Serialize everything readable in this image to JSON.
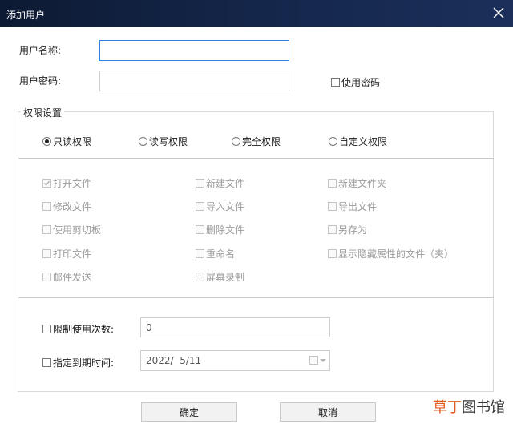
{
  "window": {
    "title": "添加用户"
  },
  "form": {
    "username_label": "用户名称:",
    "username_value": "",
    "password_label": "用户密码:",
    "password_value": "",
    "use_password_label": "使用密码",
    "use_password_checked": false
  },
  "permissions": {
    "group_title": "权限设置",
    "levels": [
      {
        "label": "只读权限",
        "selected": true
      },
      {
        "label": "读写权限",
        "selected": false
      },
      {
        "label": "完全权限",
        "selected": false
      },
      {
        "label": "自定义权限",
        "selected": false
      }
    ],
    "options": [
      {
        "label": "打开文件",
        "checked": true
      },
      {
        "label": "新建文件",
        "checked": false
      },
      {
        "label": "新建文件夹",
        "checked": false
      },
      {
        "label": "修改文件",
        "checked": false
      },
      {
        "label": "导入文件",
        "checked": false
      },
      {
        "label": "导出文件",
        "checked": false
      },
      {
        "label": "使用剪切板",
        "checked": false
      },
      {
        "label": "删除文件",
        "checked": false
      },
      {
        "label": "另存为",
        "checked": false
      },
      {
        "label": "打印文件",
        "checked": false
      },
      {
        "label": "重命名",
        "checked": false
      },
      {
        "label": "显示隐藏属性的文件（夹）",
        "checked": false
      },
      {
        "label": "邮件发送",
        "checked": false
      },
      {
        "label": "屏幕录制",
        "checked": false
      }
    ]
  },
  "limits": {
    "use_count_label": "限制使用次数:",
    "use_count_value": "0",
    "expire_label": "指定到期时间:",
    "expire_value": "2022/  5/11"
  },
  "buttons": {
    "ok": "确定",
    "cancel": "取消"
  },
  "watermark": {
    "part1": "草丁",
    "part2": "图书馆"
  },
  "colors": {
    "titlebar": "#14264a",
    "focus_border": "#2f7fdd"
  }
}
